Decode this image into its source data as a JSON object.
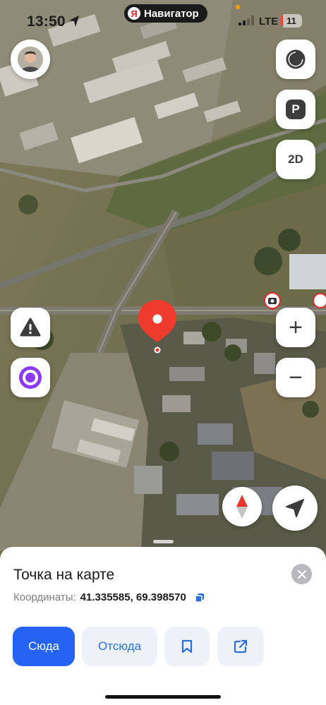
{
  "status_bar": {
    "time": "13:50",
    "app_name": "Навигатор",
    "app_logo": "Я",
    "network": "LTE",
    "battery": "11",
    "battery_level_percent": 11,
    "battery_color": "#ff3b30"
  },
  "map": {
    "type": "satellite",
    "pin_color": "#ef3b2c",
    "camera_marker": "speed-camera"
  },
  "controls": {
    "mode_label": "2D",
    "parking_label": "P",
    "zoom_in": "+",
    "zoom_out": "−"
  },
  "sheet": {
    "title": "Точка на карте",
    "coords_label": "Координаты:",
    "coords_value": "41.335585, 69.398570",
    "actions": {
      "here": "Сюда",
      "from": "Отсюда"
    }
  },
  "colors": {
    "accent": "#2563f4",
    "accent_soft": "#eef1f7",
    "alice": "#8b3bf6"
  }
}
